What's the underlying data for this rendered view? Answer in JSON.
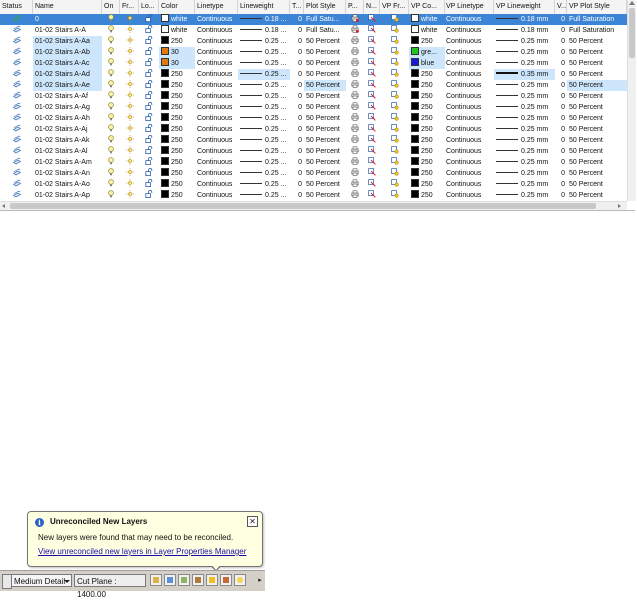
{
  "columns": [
    "Status",
    "Name",
    "On",
    "Fr...",
    "Lo...",
    "Color",
    "Linetype",
    "Lineweight",
    "T...",
    "Plot Style",
    "P...",
    "N...",
    "VP Fr...",
    "VP Co...",
    "VP Linetype",
    "VP Lineweight",
    "V...",
    "VP Plot Style"
  ],
  "rows": [
    {
      "name": "0",
      "color": "white",
      "color_hex": "#ffffff",
      "linetype": "Continuous",
      "lineweight": "0.18 ...",
      "t": "0",
      "plot_style": "Full Satu...",
      "vp_color": "white",
      "vp_color_hex": "#ffffff",
      "vp_linetype": "Continuous",
      "vp_lineweight": "0.18 mm",
      "v": "0",
      "vp_plot_style": "Full Saturation",
      "status": "current"
    },
    {
      "name": "01-02 Stairs A-A",
      "color": "white",
      "color_hex": "#ffffff",
      "linetype": "Continuous",
      "lineweight": "0.18 ...",
      "t": "0",
      "plot_style": "Full Satu...",
      "vp_color": "white",
      "vp_color_hex": "#ffffff",
      "vp_linetype": "Continuous",
      "vp_lineweight": "0.18 mm",
      "v": "0",
      "vp_plot_style": "Full Saturation",
      "status": "layer"
    },
    {
      "name": "01-02 Stairs A-Aa",
      "color": "250",
      "color_hex": "#000000",
      "linetype": "Continuous",
      "lineweight": "0.25 ...",
      "t": "0",
      "plot_style": "50 Percent",
      "vp_color": "250",
      "vp_color_hex": "#000000",
      "vp_linetype": "Continuous",
      "vp_lineweight": "0.25 mm",
      "v": "0",
      "vp_plot_style": "50 Percent",
      "status": "layer"
    },
    {
      "name": "01-02 Stairs A-Ab",
      "color": "30",
      "color_hex": "#e07a10",
      "linetype": "Continuous",
      "lineweight": "0.25 ...",
      "t": "0",
      "plot_style": "50 Percent",
      "vp_color": "gre...",
      "vp_color_hex": "#22c322",
      "vp_linetype": "Continuous",
      "vp_lineweight": "0.25 mm",
      "v": "0",
      "vp_plot_style": "50 Percent",
      "status": "layer"
    },
    {
      "name": "01-02 Stairs A-Ac",
      "color": "30",
      "color_hex": "#e07a10",
      "linetype": "Continuous",
      "lineweight": "0.25 ...",
      "t": "0",
      "plot_style": "50 Percent",
      "vp_color": "blue",
      "vp_color_hex": "#1a1ad6",
      "vp_linetype": "Continuous",
      "vp_lineweight": "0.25 mm",
      "v": "0",
      "vp_plot_style": "50 Percent",
      "status": "layer"
    },
    {
      "name": "01-02 Stairs A-Ad",
      "color": "250",
      "color_hex": "#000000",
      "linetype": "Continuous",
      "lineweight": "0.25 ...",
      "t": "0",
      "plot_style": "50 Percent",
      "vp_color": "250",
      "vp_color_hex": "#000000",
      "vp_linetype": "Continuous",
      "vp_lineweight": "0.35 mm",
      "v": "0",
      "vp_plot_style": "50 Percent",
      "status": "layer"
    },
    {
      "name": "01-02 Stairs A-Ae",
      "color": "250",
      "color_hex": "#000000",
      "linetype": "Continuous",
      "lineweight": "0.25 ...",
      "t": "0",
      "plot_style": "50 Percent",
      "vp_color": "250",
      "vp_color_hex": "#000000",
      "vp_linetype": "Continuous",
      "vp_lineweight": "0.25 mm",
      "v": "0",
      "vp_plot_style": "50 Percent",
      "status": "layer"
    },
    {
      "name": "01-02 Stairs A-Af",
      "color": "250",
      "color_hex": "#000000",
      "linetype": "Continuous",
      "lineweight": "0.25 ...",
      "t": "0",
      "plot_style": "50 Percent",
      "vp_color": "250",
      "vp_color_hex": "#000000",
      "vp_linetype": "Continuous",
      "vp_lineweight": "0.25 mm",
      "v": "0",
      "vp_plot_style": "50 Percent",
      "status": "layer"
    },
    {
      "name": "01-02 Stairs A-Ag",
      "color": "250",
      "color_hex": "#000000",
      "linetype": "Continuous",
      "lineweight": "0.25 ...",
      "t": "0",
      "plot_style": "50 Percent",
      "vp_color": "250",
      "vp_color_hex": "#000000",
      "vp_linetype": "Continuous",
      "vp_lineweight": "0.25 mm",
      "v": "0",
      "vp_plot_style": "50 Percent",
      "status": "layer"
    },
    {
      "name": "01-02 Stairs A-Ah",
      "color": "250",
      "color_hex": "#000000",
      "linetype": "Continuous",
      "lineweight": "0.25 ...",
      "t": "0",
      "plot_style": "50 Percent",
      "vp_color": "250",
      "vp_color_hex": "#000000",
      "vp_linetype": "Continuous",
      "vp_lineweight": "0.25 mm",
      "v": "0",
      "vp_plot_style": "50 Percent",
      "status": "layer"
    },
    {
      "name": "01-02 Stairs A-Aj",
      "color": "250",
      "color_hex": "#000000",
      "linetype": "Continuous",
      "lineweight": "0.25 ...",
      "t": "0",
      "plot_style": "50 Percent",
      "vp_color": "250",
      "vp_color_hex": "#000000",
      "vp_linetype": "Continuous",
      "vp_lineweight": "0.25 mm",
      "v": "0",
      "vp_plot_style": "50 Percent",
      "status": "layer"
    },
    {
      "name": "01-02 Stairs A-Ak",
      "color": "250",
      "color_hex": "#000000",
      "linetype": "Continuous",
      "lineweight": "0.25 ...",
      "t": "0",
      "plot_style": "50 Percent",
      "vp_color": "250",
      "vp_color_hex": "#000000",
      "vp_linetype": "Continuous",
      "vp_lineweight": "0.25 mm",
      "v": "0",
      "vp_plot_style": "50 Percent",
      "status": "layer"
    },
    {
      "name": "01-02 Stairs A-Al",
      "color": "250",
      "color_hex": "#000000",
      "linetype": "Continuous",
      "lineweight": "0.25 ...",
      "t": "0",
      "plot_style": "50 Percent",
      "vp_color": "250",
      "vp_color_hex": "#000000",
      "vp_linetype": "Continuous",
      "vp_lineweight": "0.25 mm",
      "v": "0",
      "vp_plot_style": "50 Percent",
      "status": "layer"
    },
    {
      "name": "01-02 Stairs A-Am",
      "color": "250",
      "color_hex": "#000000",
      "linetype": "Continuous",
      "lineweight": "0.25 ...",
      "t": "0",
      "plot_style": "50 Percent",
      "vp_color": "250",
      "vp_color_hex": "#000000",
      "vp_linetype": "Continuous",
      "vp_lineweight": "0.25 mm",
      "v": "0",
      "vp_plot_style": "50 Percent",
      "status": "layer"
    },
    {
      "name": "01-02 Stairs A-An",
      "color": "250",
      "color_hex": "#000000",
      "linetype": "Continuous",
      "lineweight": "0.25 ...",
      "t": "0",
      "plot_style": "50 Percent",
      "vp_color": "250",
      "vp_color_hex": "#000000",
      "vp_linetype": "Continuous",
      "vp_lineweight": "0.25 mm",
      "v": "0",
      "vp_plot_style": "50 Percent",
      "status": "layer"
    },
    {
      "name": "01-02 Stairs A-Ao",
      "color": "250",
      "color_hex": "#000000",
      "linetype": "Continuous",
      "lineweight": "0.25 ...",
      "t": "0",
      "plot_style": "50 Percent",
      "vp_color": "250",
      "vp_color_hex": "#000000",
      "vp_linetype": "Continuous",
      "vp_lineweight": "0.25 mm",
      "v": "0",
      "vp_plot_style": "50 Percent",
      "status": "layer"
    },
    {
      "name": "01-02 Stairs A-Ap",
      "color": "250",
      "color_hex": "#000000",
      "linetype": "Continuous",
      "lineweight": "0.25 ...",
      "t": "0",
      "plot_style": "50 Percent",
      "vp_color": "250",
      "vp_color_hex": "#000000",
      "vp_linetype": "Continuous",
      "vp_lineweight": "0.25 mm",
      "v": "0",
      "vp_plot_style": "50 Percent",
      "status": "layer"
    }
  ],
  "highlighted_rows": [
    2,
    3,
    4,
    5,
    6
  ],
  "selected_row": 0,
  "balloon": {
    "title": "Unreconciled New Layers",
    "message": "New layers were found that may need to be reconciled.",
    "link": "View unreconciled new layers in Layer Properties Manager",
    "close_symbol": "✕",
    "info_symbol": "i"
  },
  "statusbar": {
    "detail_level": "Medium Detail",
    "cut_plane": "Cut Plane : 1400.00",
    "menu_symbol": "▸"
  },
  "accent_colors": {
    "selection": "#3c84d6",
    "highlight": "#cde6fb",
    "balloon": "#ffffe1"
  }
}
